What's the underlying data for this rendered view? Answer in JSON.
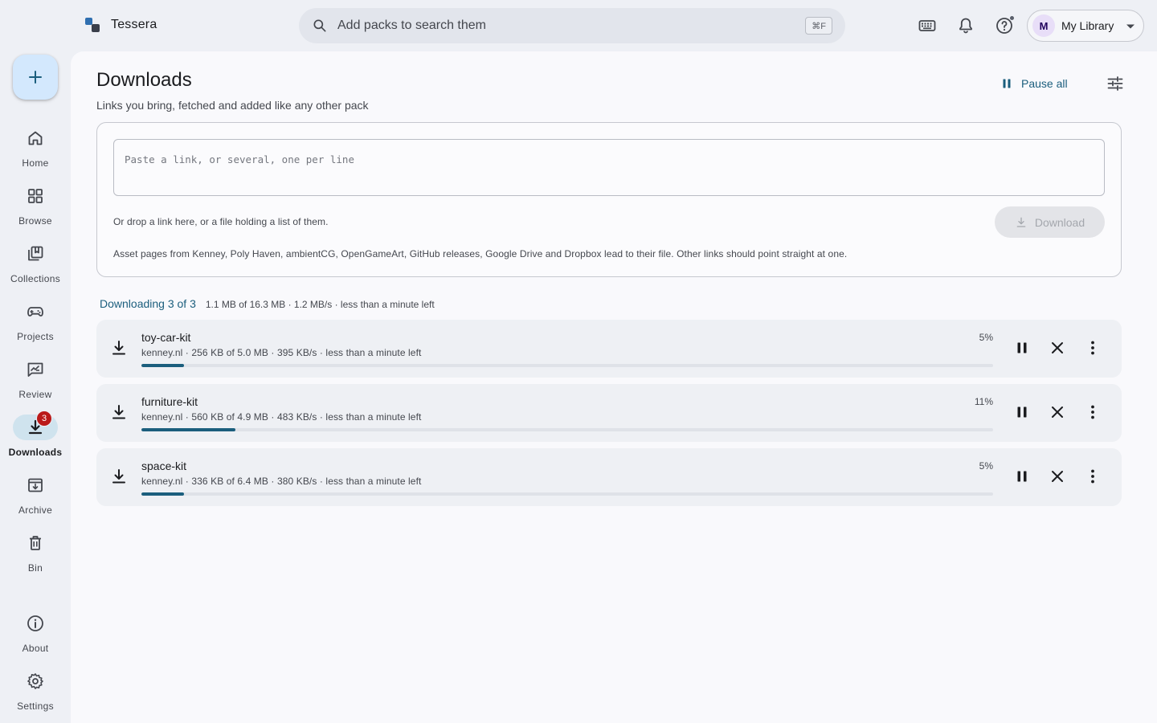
{
  "app": {
    "name": "Tessera"
  },
  "search": {
    "placeholder": "Add packs to search them",
    "shortcut": "⌘F"
  },
  "header": {
    "icons": [
      "keyboard-icon",
      "bell-icon",
      "help-icon"
    ],
    "library": {
      "avatar_initial": "M",
      "label": "My Library"
    }
  },
  "rail": {
    "fab_icon": "plus-icon",
    "items": [
      {
        "label": "Home",
        "icon": "home-icon"
      },
      {
        "label": "Browse",
        "icon": "grid-icon"
      },
      {
        "label": "Collections",
        "icon": "collections-icon"
      },
      {
        "label": "Projects",
        "icon": "gamepad-icon"
      },
      {
        "label": "Review",
        "icon": "review-icon"
      },
      {
        "label": "Downloads",
        "icon": "download-icon",
        "badge": "3",
        "active": true
      },
      {
        "label": "Archive",
        "icon": "archive-icon"
      },
      {
        "label": "Bin",
        "icon": "trash-icon"
      },
      {
        "label": "About",
        "icon": "info-icon"
      },
      {
        "label": "Settings",
        "icon": "gear-icon"
      }
    ]
  },
  "page": {
    "title": "Downloads",
    "subtitle": "Links you bring, fetched and added like any other pack",
    "pause_all_label": "Pause all"
  },
  "drop": {
    "placeholder": "Paste a link, or several, one per line",
    "hint": "Or drop a link here, or a file holding a list of them.",
    "download_label": "Download",
    "sources_note": "Asset pages from Kenney, Poly Haven, ambientCG, OpenGameArt, GitHub releases, Google Drive and Dropbox lead to their file. Other links should point straight at one."
  },
  "summary": {
    "title": "Downloading 3 of 3",
    "stats": "1.1 MB of 16.3 MB · 1.2 MB/s · less than a minute left"
  },
  "downloads": [
    {
      "name": "toy-car-kit",
      "meta": "kenney.nl · 256 KB of 5.0 MB · 395 KB/s · less than a minute left",
      "percent_label": "5%",
      "progress": 0.05
    },
    {
      "name": "furniture-kit",
      "meta": "kenney.nl · 560 KB of 4.9 MB · 483 KB/s · less than a minute left",
      "percent_label": "11%",
      "progress": 0.11
    },
    {
      "name": "space-kit",
      "meta": "kenney.nl · 336 KB of 6.4 MB · 380 KB/s · less than a minute left",
      "percent_label": "5%",
      "progress": 0.05
    }
  ],
  "colors": {
    "accent": "#1b5e7d",
    "badge": "#ba1a1a",
    "fab": "#d3e8fd",
    "active_pill": "#cfe3ee"
  }
}
